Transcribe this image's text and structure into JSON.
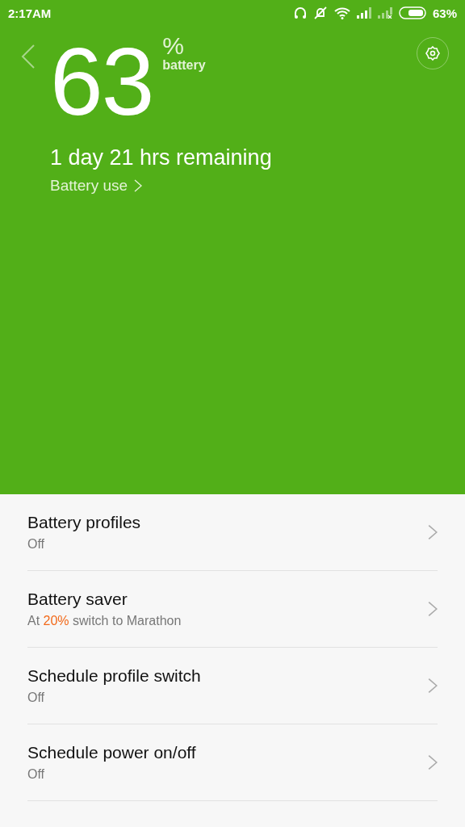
{
  "status_bar": {
    "time": "2:17AM",
    "battery": "63%"
  },
  "header": {
    "percent": "63",
    "unit": "%",
    "unit_label": "battery",
    "remaining": "1 day 21 hrs remaining",
    "link": "Battery use"
  },
  "settings": [
    {
      "title": "Battery profiles",
      "subtitle": [
        {
          "text": "Off",
          "highlight": false
        }
      ]
    },
    {
      "title": "Battery saver",
      "subtitle": [
        {
          "text": "At ",
          "highlight": false
        },
        {
          "text": "20%",
          "highlight": true
        },
        {
          "text": " switch to Marathon",
          "highlight": false
        }
      ]
    },
    {
      "title": "Schedule profile switch",
      "subtitle": [
        {
          "text": "Off",
          "highlight": false
        }
      ]
    },
    {
      "title": "Schedule power on/off",
      "subtitle": [
        {
          "text": "Off",
          "highlight": false
        }
      ]
    }
  ]
}
